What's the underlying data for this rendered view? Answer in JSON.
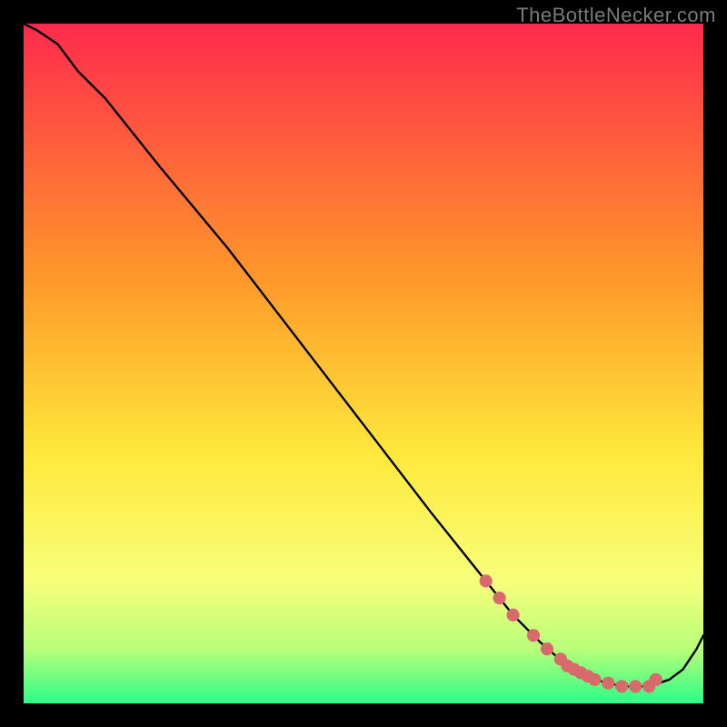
{
  "watermark": "TheBottleNecker.com",
  "colors": {
    "background": "#000000",
    "curve": "#000000",
    "markers": "#d76b6b",
    "gradient_top": "#ff2a4d",
    "gradient_mid1": "#ff9a2a",
    "gradient_mid2": "#ffe83a",
    "gradient_mid3": "#f7ff7a",
    "gradient_mid4": "#b8ff7a",
    "gradient_bottom": "#2dfc87"
  },
  "chart_data": {
    "type": "line",
    "title": "",
    "xlabel": "",
    "ylabel": "",
    "xlim": [
      0,
      100
    ],
    "ylim": [
      0,
      100
    ],
    "series": [
      {
        "name": "curve",
        "x": [
          0,
          2,
          5,
          8,
          12,
          20,
          30,
          40,
          50,
          60,
          68,
          72,
          76,
          80,
          84,
          88,
          92,
          95,
          97,
          99,
          100
        ],
        "y": [
          100,
          99,
          97,
          93,
          89,
          79,
          67,
          54,
          41,
          28,
          18,
          13,
          9,
          5.5,
          3.5,
          2.5,
          2.5,
          3.5,
          5,
          8,
          10
        ]
      }
    ],
    "markers": {
      "name": "highlight-points",
      "x": [
        68,
        70,
        72,
        75,
        77,
        79,
        80,
        81,
        82,
        83,
        84,
        86,
        88,
        90,
        92,
        93
      ],
      "y": [
        18,
        15.5,
        13,
        10,
        8,
        6.5,
        5.5,
        5,
        4.5,
        4,
        3.5,
        3,
        2.5,
        2.5,
        2.5,
        3.5
      ]
    }
  }
}
